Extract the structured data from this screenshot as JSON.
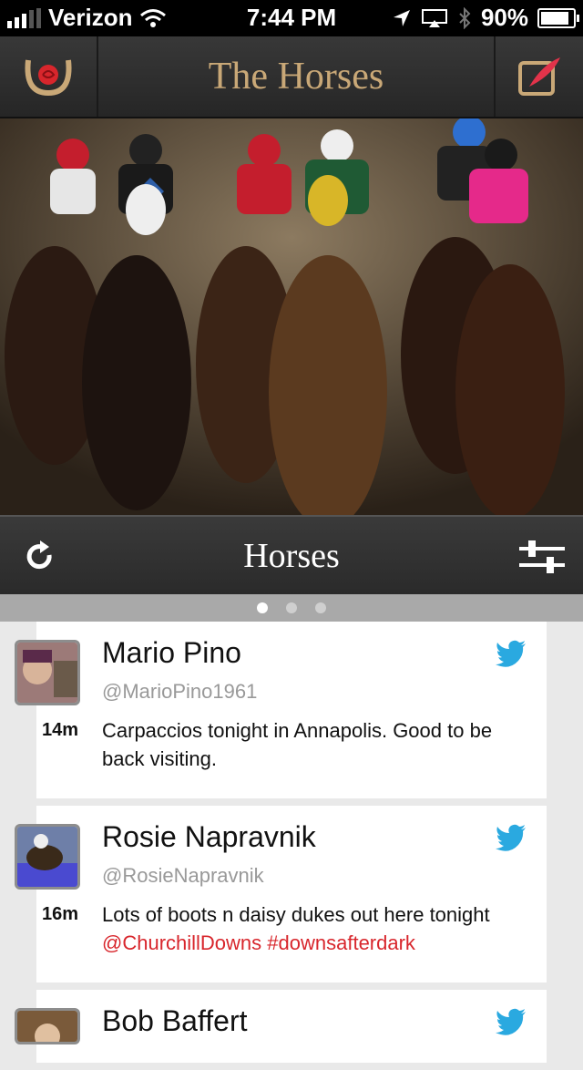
{
  "status_bar": {
    "carrier": "Verizon",
    "time": "7:44 PM",
    "battery": "90%",
    "signal_icon": "signal-bars-icon",
    "wifi_icon": "wifi-icon",
    "location_icon": "location-arrow-icon",
    "airplay_icon": "airplay-icon",
    "bluetooth_icon": "bluetooth-icon"
  },
  "nav": {
    "title": "The Horses",
    "logo_icon": "horseshoe-rose-icon",
    "compose_icon": "compose-quill-icon",
    "accent": "#c9a877",
    "compose_accent": "#e2334a"
  },
  "hero": {
    "image": "racing-horses-photo"
  },
  "feed_header": {
    "title": "Horses",
    "refresh_icon": "refresh-icon",
    "filter_icon": "sliders-icon"
  },
  "pager": {
    "pages": 3,
    "active": 0
  },
  "tweets": [
    {
      "name": "Mario Pino",
      "handle": "@MarioPino1961",
      "time": "14m",
      "text": "Carpaccios tonight in Annapolis. Good to be back visiting.",
      "link_text": "",
      "source_icon": "twitter-bird-icon"
    },
    {
      "name": "Rosie Napravnik",
      "handle": "@RosieNapravnik",
      "time": "16m",
      "text": "Lots of boots n daisy dukes out here tonight ",
      "link_text": "@ChurchillDowns #downsafterdark",
      "source_icon": "twitter-bird-icon"
    },
    {
      "name": "Bob Baffert",
      "source_icon": "twitter-bird-icon"
    }
  ],
  "colors": {
    "link": "#d8262c",
    "twitter": "#2aa9e0"
  }
}
